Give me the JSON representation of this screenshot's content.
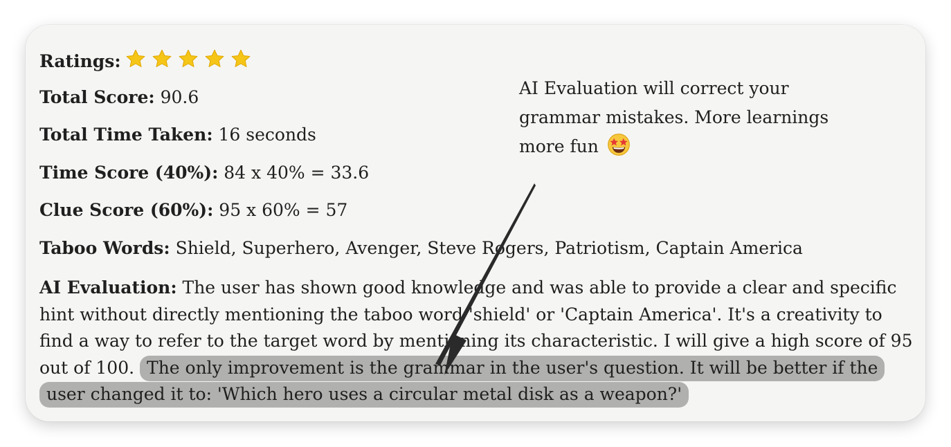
{
  "ratings": {
    "label": "Ratings:",
    "stars": 5,
    "max": 5,
    "star_color": "#f5c518"
  },
  "total_score": {
    "label": "Total Score:",
    "value": "90.6"
  },
  "total_time": {
    "label": "Total Time Taken:",
    "value": "16 seconds"
  },
  "time_score": {
    "label": "Time Score (40%):",
    "value": "84 x 40% = 33.6"
  },
  "clue_score": {
    "label": "Clue Score (60%):",
    "value": "95 x 60% = 57"
  },
  "taboo_words": {
    "label": "Taboo Words:",
    "value": "Shield, Superhero, Avenger, Steve Rogers, Patriotism, Captain America"
  },
  "ai_evaluation": {
    "label": "AI Evaluation:",
    "text": "The user has shown good knowledge and was able to provide a clear and specific hint without directly mentioning the taboo word 'shield' or 'Captain America'. It's a creativity to find a way to refer to the target word by mentioning its characteristic. I will give a high score of 95 out of 100.",
    "highlighted": "The only improvement is the grammar in the user's question. It will be better if the user changed it to: 'Which hero uses a circular metal disk as a weapon?'"
  },
  "annotation": {
    "text": "AI Evaluation will correct your grammar mistakes. More learnings more fun",
    "emoji_icon": "star-struck-emoji-icon"
  },
  "colors": {
    "highlight": "#b0b0ae",
    "card_background": "#f5f5f3",
    "arrow": "#2a2a2a"
  }
}
